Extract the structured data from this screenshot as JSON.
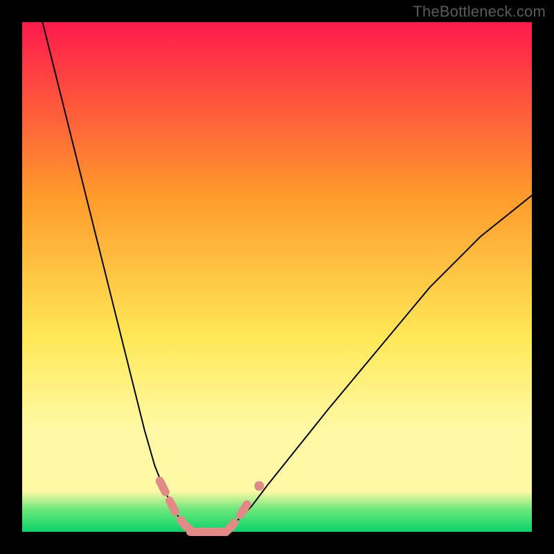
{
  "watermark": "TheBottleneck.com",
  "chart_data": {
    "type": "line",
    "title": "",
    "xlabel": "",
    "ylabel": "",
    "xlim": [
      0,
      100
    ],
    "ylim": [
      0,
      100
    ],
    "grid": false,
    "legend": false,
    "background_gradient_top": "#ff1a4d",
    "background_gradient_mid1": "#ff9a2b",
    "background_gradient_mid2": "#ffe958",
    "background_gradient_low1": "#fff9a6",
    "background_gradient_low2": "#6fe87a",
    "background_gradient_low3": "#0ad26a",
    "series": [
      {
        "name": "curve-left",
        "color": "#000000",
        "stroke_width": 2,
        "x": [
          4,
          6,
          8,
          10,
          12,
          14,
          16,
          18,
          20,
          22,
          24,
          26,
          28,
          30,
          32,
          34
        ],
        "values": [
          100,
          92,
          84,
          76,
          68,
          60,
          52,
          44,
          36,
          28,
          20,
          13,
          8,
          4,
          1,
          0
        ]
      },
      {
        "name": "curve-right",
        "color": "#000000",
        "stroke_width": 2,
        "x": [
          40,
          42,
          45,
          48,
          52,
          56,
          60,
          65,
          70,
          75,
          80,
          85,
          90,
          95,
          100
        ],
        "values": [
          0,
          2,
          5,
          9,
          14,
          19,
          24,
          30,
          36,
          42,
          48,
          53,
          58,
          62,
          66
        ]
      },
      {
        "name": "dash-left",
        "color": "#e28a88",
        "stroke_width": 12,
        "dash": true,
        "x": [
          27,
          28,
          29,
          30,
          31,
          32,
          33
        ],
        "values": [
          10,
          8,
          6,
          4,
          2.5,
          1.2,
          0.5
        ]
      },
      {
        "name": "flat-bottom",
        "color": "#e28a88",
        "stroke_width": 12,
        "x": [
          33,
          40
        ],
        "values": [
          0,
          0
        ]
      },
      {
        "name": "dash-right",
        "color": "#e28a88",
        "stroke_width": 12,
        "dash": true,
        "x": [
          40,
          41,
          42,
          43,
          44,
          45
        ],
        "values": [
          0,
          1,
          2.2,
          3.6,
          5.2,
          7
        ]
      },
      {
        "name": "dot-right",
        "color": "#e28a88",
        "type": "scatter",
        "radius": 7,
        "x": [
          46.5
        ],
        "values": [
          9
        ]
      }
    ],
    "frame": {
      "inner_x": 4,
      "inner_y": 4,
      "inner_w": 92,
      "inner_h": 92,
      "border_color": "#000000"
    }
  }
}
